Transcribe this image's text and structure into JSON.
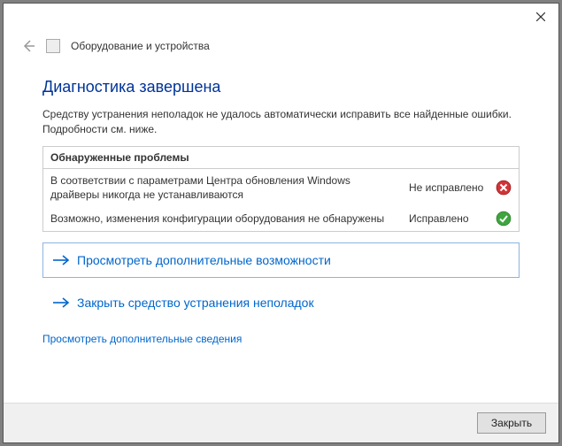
{
  "header": {
    "title": "Оборудование и устройства"
  },
  "main": {
    "heading": "Диагностика завершена",
    "summary": "Средству устранения неполадок не удалось автоматически исправить все найденные ошибки. Подробности см. ниже."
  },
  "problems": {
    "header": "Обнаруженные проблемы",
    "items": [
      {
        "desc": "В соответствии с параметрами Центра обновления Windows драйверы никогда не устанавливаются",
        "status": "Не исправлено",
        "ok": false
      },
      {
        "desc": "Возможно, изменения конфигурации оборудования не обнаружены",
        "status": "Исправлено",
        "ok": true
      }
    ]
  },
  "actions": {
    "explore": "Просмотреть дополнительные возможности",
    "close_tool": "Закрыть средство устранения неполадок",
    "more_info": "Просмотреть дополнительные сведения"
  },
  "footer": {
    "close": "Закрыть"
  }
}
